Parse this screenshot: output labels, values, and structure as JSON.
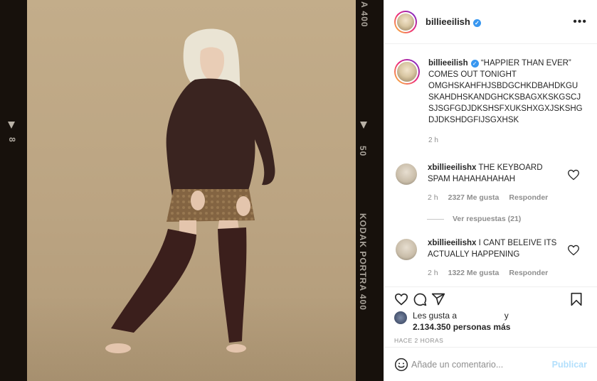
{
  "film": {
    "top_marker": "A 400",
    "frame_number": "8",
    "mid_number": "50",
    "brand": "KODAK PORTRA 400"
  },
  "post": {
    "username": "billieeilish",
    "caption_text": "“HAPPIER THAN EVER” COMES OUT TONIGHT OMGHSKAHFHJSBDGCHKDBAHDKGUSKAHDHSKANDGHCKSBAGXKSKGSCJSJSGFGDJDKSHSFXUKSHXGXJSKSHGDJDKSHDGFIJSGXHSK",
    "caption_lines": [
      "“HAPPIER THAN EVER”",
      "COMES OUT TONIGHT",
      "OMGHSKAHFHJSBDGCHKDBAHDKGU",
      "SKAHDHSKANDGHCKSBAGXKSKGSCJ",
      "SJSGFGDJDKSHSFXUKSHXGXJSKSHG",
      "DJDKSHDGFIJSGXHSK"
    ],
    "caption_time": "2 h",
    "comments": [
      {
        "username": "xbillieeilishx",
        "lines": [
          "THE KEYBOARD",
          "SPAM HAHAHAHAHAH"
        ],
        "time": "2 h",
        "likes": "2327 Me gusta",
        "reply": "Responder"
      },
      {
        "username": "xbillieeilishx",
        "lines": [
          "I CANT BELEIVE ITS",
          "ACTUALLY HAPPENING"
        ],
        "time": "2 h",
        "likes": "1322 Me gusta",
        "reply": "Responder"
      }
    ],
    "view_replies": "Ver respuestas (21)",
    "liked_by_prefix": "Les gusta a",
    "liked_by_suffix": "y",
    "likes_count": "2.134.350 personas más",
    "posted_ago": "HACE 2 HORAS",
    "comment_placeholder": "Añade un comentario...",
    "publish_label": "Publicar",
    "more_icon": "•••"
  },
  "colors": {
    "accent": "#3897f0",
    "publish_disabled": "#b2dffc",
    "muted": "#8e8e8e",
    "film_border": "#17110c"
  },
  "icons": {
    "verified": "verified-badge-icon",
    "heart": "heart-icon",
    "comment": "comment-icon",
    "share": "share-icon",
    "bookmark": "bookmark-icon",
    "emoji": "emoji-icon",
    "more": "more-options-icon"
  }
}
